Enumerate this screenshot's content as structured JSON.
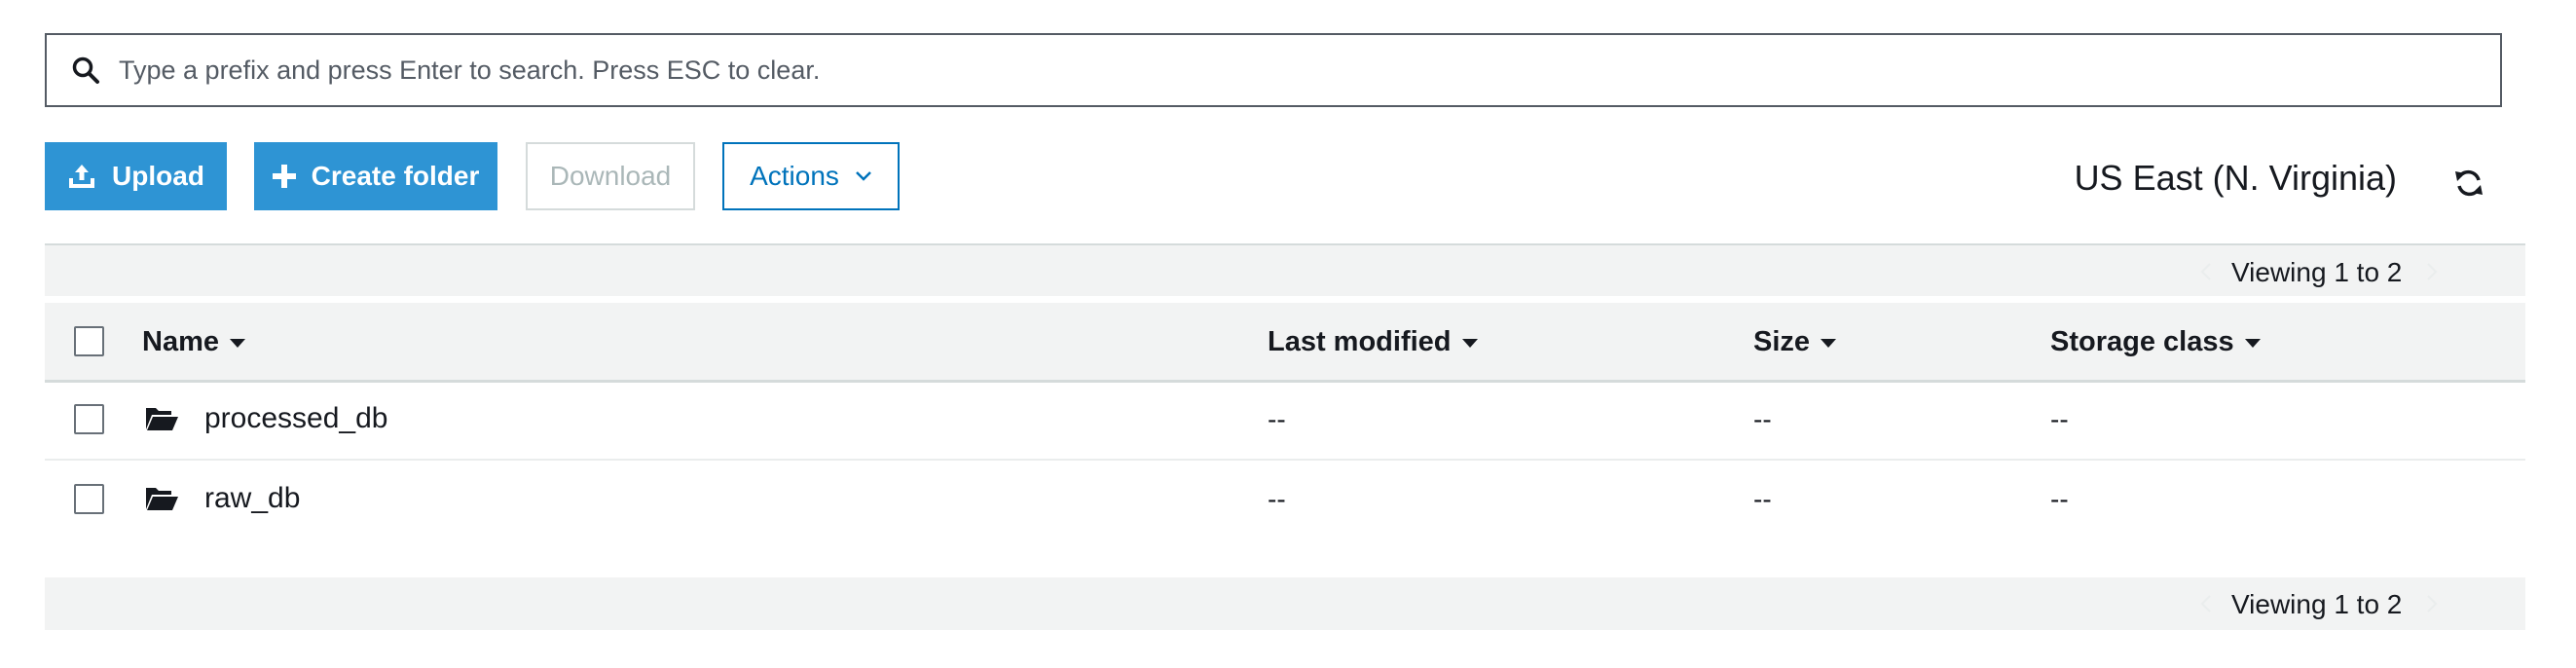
{
  "search": {
    "placeholder": "Type a prefix and press Enter to search. Press ESC to clear.",
    "value": "",
    "icon": "search-icon"
  },
  "toolbar": {
    "upload_label": "Upload",
    "create_folder_label": "Create folder",
    "download_label": "Download",
    "actions_label": "Actions",
    "region_label": "US East (N. Virginia)"
  },
  "pagination": {
    "top_label": "Viewing 1 to 2",
    "bottom_label": "Viewing 1 to 2"
  },
  "table": {
    "columns": [
      "Name",
      "Last modified",
      "Size",
      "Storage class"
    ],
    "rows": [
      {
        "name": "processed_db",
        "last_modified": "--",
        "size": "--",
        "storage_class": "--"
      },
      {
        "name": "raw_db",
        "last_modified": "--",
        "size": "--",
        "storage_class": "--"
      }
    ]
  },
  "colors": {
    "primary": "#2e94d4",
    "actions_border": "#0073bb",
    "disabled_text": "#aab7b8",
    "header_bg": "#f2f3f3"
  }
}
